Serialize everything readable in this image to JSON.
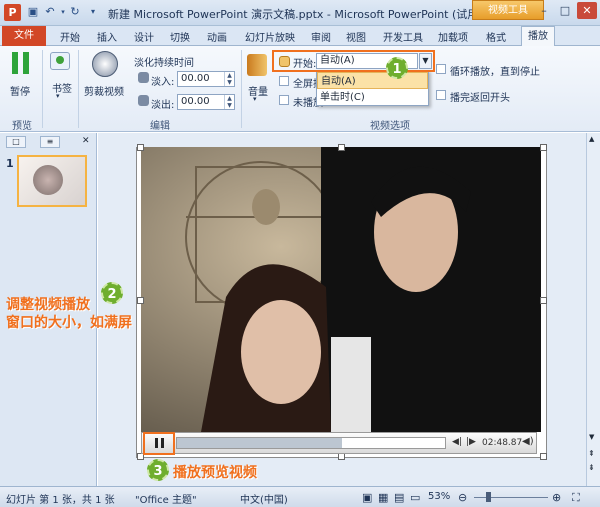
{
  "window": {
    "title": "新建 Microsoft PowerPoint 演示文稿.pptx - Microsoft PowerPoint (试用",
    "context_tab": "视频工具",
    "app_icon": "P"
  },
  "tabs": {
    "file": "文件",
    "items": [
      "开始",
      "插入",
      "设计",
      "切换",
      "动画",
      "幻灯片放映",
      "审阅",
      "视图",
      "开发工具",
      "加载项",
      "格式"
    ],
    "active": "播放"
  },
  "ribbon": {
    "preview_group": {
      "label": "预览",
      "play_button": "暂停"
    },
    "bookmark_group": {
      "bookmark_button": "书签"
    },
    "editing_group": {
      "label": "编辑",
      "trim_button": "剪裁视频",
      "fade_title": "淡化持续时间",
      "fade_in_label": "淡入:",
      "fade_in_value": "00.00",
      "fade_out_label": "淡出:",
      "fade_out_value": "00.00"
    },
    "video_options": {
      "label": "视频选项",
      "volume_button": "音量",
      "start_label": "开始:",
      "start_value": "自动(A)",
      "dropdown_options": [
        "自动(A)",
        "单击时(C)"
      ],
      "fullscreen_label": "全屏播",
      "hide_label": "未播放",
      "loop_label": "循环播放，直到停止",
      "rewind_label": "播完返回开头"
    }
  },
  "media_controls": {
    "time": "02:48.87"
  },
  "slides_pane": {
    "slide_number": "1"
  },
  "annotations": {
    "badge1": "1",
    "badge2": "2",
    "badge3": "3",
    "note2_line1": "调整视频播放",
    "note2_line2": "窗口的大小，如满屏",
    "note3": "播放预览视频"
  },
  "status": {
    "slide_info": "幻灯片 第 1 张，共 1 张",
    "theme": "\"Office 主题\"",
    "language": "中文(中国)",
    "zoom": "53%"
  },
  "colors": {
    "accent_orange": "#f0701e",
    "file_tab": "#d24726",
    "badge_green": "#6fae2e"
  }
}
